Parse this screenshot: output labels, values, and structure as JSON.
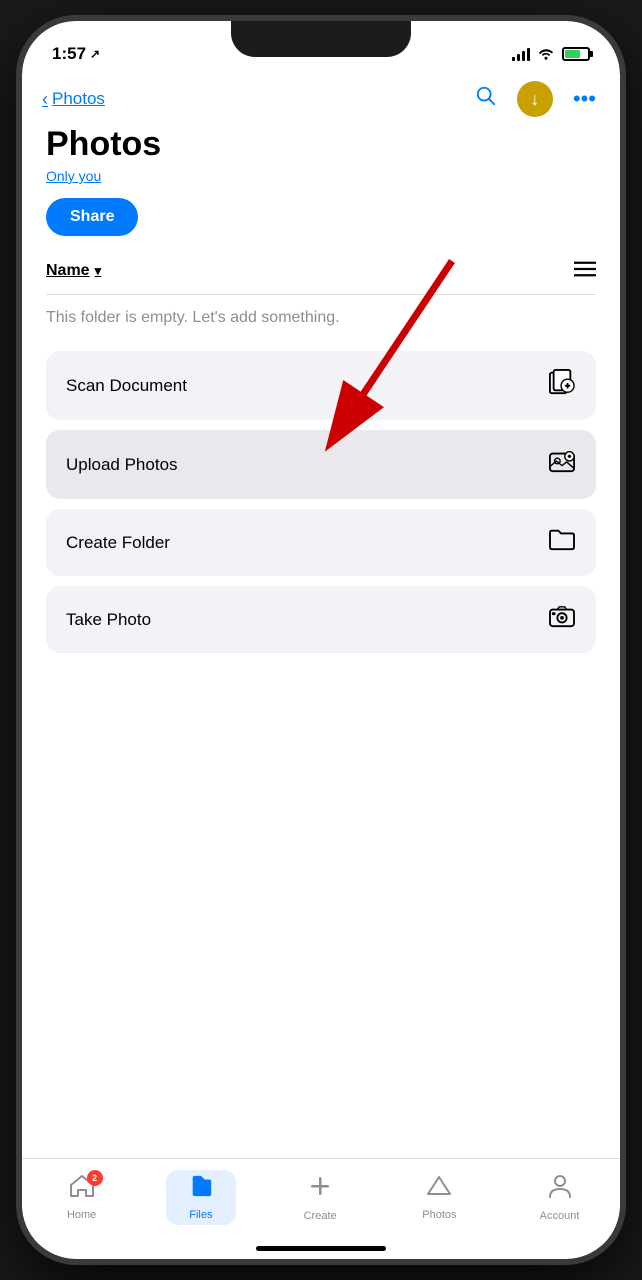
{
  "statusBar": {
    "time": "1:57",
    "locationIcon": "↗"
  },
  "navHeader": {
    "backLabel": "Photos",
    "moreLabel": "•••"
  },
  "page": {
    "title": "Photos",
    "subtitle": "Only you",
    "shareLabel": "Share",
    "sortLabel": "Name",
    "emptyMessage": "This folder is empty. Let's add something."
  },
  "actions": [
    {
      "label": "Scan Document",
      "icon": "scan"
    },
    {
      "label": "Upload Photos",
      "icon": "upload-photo"
    },
    {
      "label": "Create Folder",
      "icon": "folder"
    },
    {
      "label": "Take Photo",
      "icon": "camera"
    }
  ],
  "tabBar": {
    "items": [
      {
        "label": "Home",
        "icon": "home",
        "badge": "2",
        "active": false
      },
      {
        "label": "Files",
        "icon": "files",
        "badge": null,
        "active": true
      },
      {
        "label": "Create",
        "icon": "create",
        "badge": null,
        "active": false
      },
      {
        "label": "Photos",
        "icon": "photos-tab",
        "badge": null,
        "active": false
      },
      {
        "label": "Account",
        "icon": "account",
        "badge": null,
        "active": false
      }
    ]
  }
}
